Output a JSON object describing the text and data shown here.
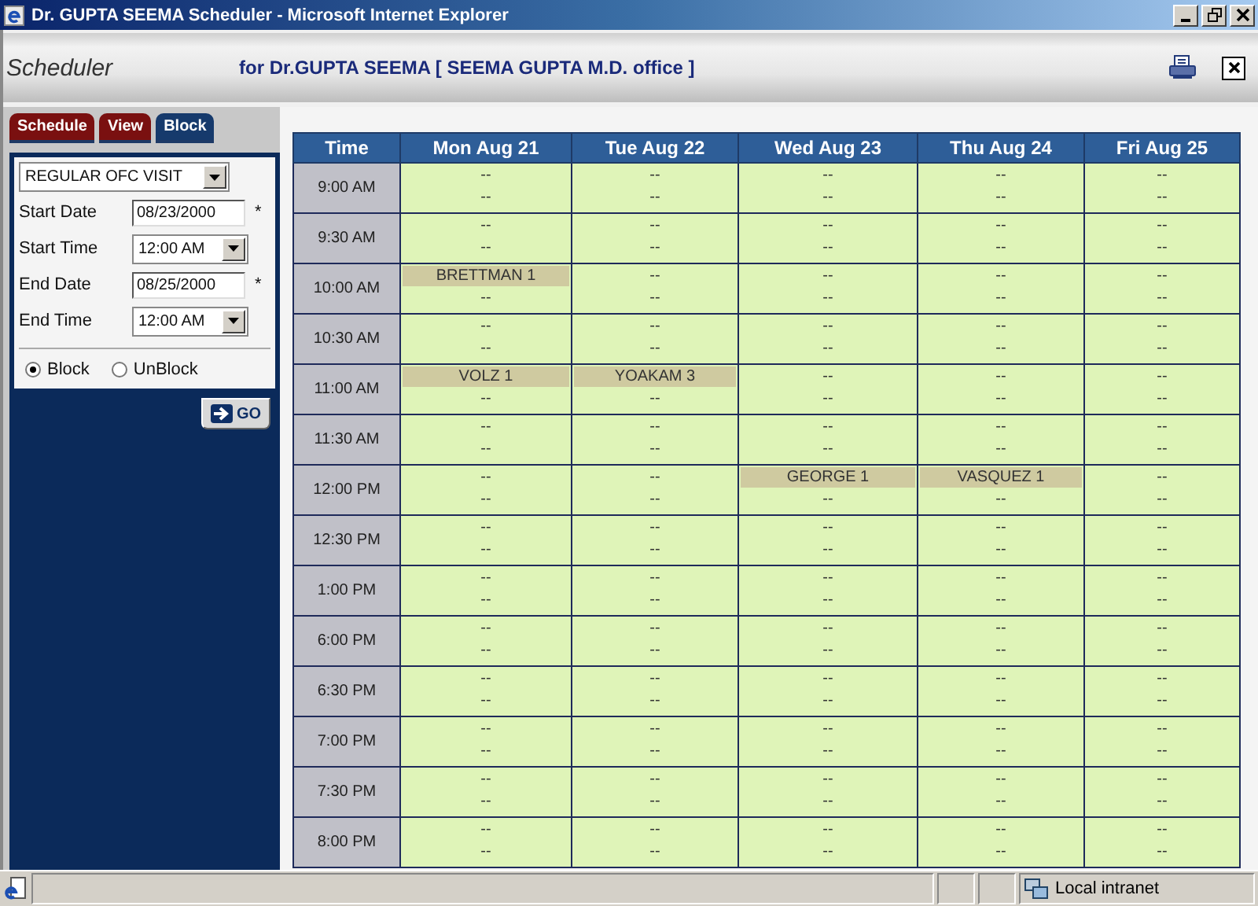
{
  "window": {
    "title": "Dr. GUPTA SEEMA Scheduler - Microsoft Internet Explorer"
  },
  "header": {
    "logo": "Scheduler",
    "subtitle": "for Dr.GUPTA SEEMA [ SEEMA GUPTA M.D. office ]"
  },
  "tabs": [
    {
      "label": "Schedule",
      "selected": false
    },
    {
      "label": "View",
      "selected": false
    },
    {
      "label": "Block",
      "selected": true
    }
  ],
  "form": {
    "visit_type": "REGULAR OFC VISIT",
    "fields": [
      {
        "kind": "date",
        "label": "Start Date",
        "value": "08/23/2000",
        "required_mark": "*"
      },
      {
        "kind": "select",
        "label": "Start Time",
        "value": "12:00 AM"
      },
      {
        "kind": "date",
        "label": "End Date",
        "value": "08/25/2000",
        "required_mark": "*"
      },
      {
        "kind": "select",
        "label": "End Time",
        "value": "12:00 AM"
      }
    ],
    "radios": [
      {
        "label": "Block",
        "selected": true
      },
      {
        "label": "UnBlock",
        "selected": false
      }
    ],
    "go_button": "GO"
  },
  "table": {
    "columns": [
      "Time",
      "Mon Aug 21",
      "Tue Aug 22",
      "Wed Aug 23",
      "Thu Aug 24",
      "Fri Aug 25"
    ],
    "rows": [
      {
        "cells": [
          {
            "kind": "time",
            "text": "9:00 AM"
          },
          {
            "kind": "slots",
            "slots": [
              {
                "text": "--",
                "booked": false
              },
              {
                "text": "--",
                "booked": false
              }
            ]
          },
          {
            "kind": "slots",
            "slots": [
              {
                "text": "--",
                "booked": false
              },
              {
                "text": "--",
                "booked": false
              }
            ]
          },
          {
            "kind": "slots",
            "slots": [
              {
                "text": "--",
                "booked": false
              },
              {
                "text": "--",
                "booked": false
              }
            ]
          },
          {
            "kind": "slots",
            "slots": [
              {
                "text": "--",
                "booked": false
              },
              {
                "text": "--",
                "booked": false
              }
            ]
          },
          {
            "kind": "slots",
            "slots": [
              {
                "text": "--",
                "booked": false
              },
              {
                "text": "--",
                "booked": false
              }
            ]
          }
        ]
      },
      {
        "cells": [
          {
            "kind": "time",
            "text": "9:30 AM"
          },
          {
            "kind": "slots",
            "slots": [
              {
                "text": "--",
                "booked": false
              },
              {
                "text": "--",
                "booked": false
              }
            ]
          },
          {
            "kind": "slots",
            "slots": [
              {
                "text": "--",
                "booked": false
              },
              {
                "text": "--",
                "booked": false
              }
            ]
          },
          {
            "kind": "slots",
            "slots": [
              {
                "text": "--",
                "booked": false
              },
              {
                "text": "--",
                "booked": false
              }
            ]
          },
          {
            "kind": "slots",
            "slots": [
              {
                "text": "--",
                "booked": false
              },
              {
                "text": "--",
                "booked": false
              }
            ]
          },
          {
            "kind": "slots",
            "slots": [
              {
                "text": "--",
                "booked": false
              },
              {
                "text": "--",
                "booked": false
              }
            ]
          }
        ]
      },
      {
        "cells": [
          {
            "kind": "time",
            "text": "10:00 AM"
          },
          {
            "kind": "slots",
            "slots": [
              {
                "text": "BRETTMAN 1",
                "booked": true
              },
              {
                "text": "--",
                "booked": false
              }
            ]
          },
          {
            "kind": "slots",
            "slots": [
              {
                "text": "--",
                "booked": false
              },
              {
                "text": "--",
                "booked": false
              }
            ]
          },
          {
            "kind": "slots",
            "slots": [
              {
                "text": "--",
                "booked": false
              },
              {
                "text": "--",
                "booked": false
              }
            ]
          },
          {
            "kind": "slots",
            "slots": [
              {
                "text": "--",
                "booked": false
              },
              {
                "text": "--",
                "booked": false
              }
            ]
          },
          {
            "kind": "slots",
            "slots": [
              {
                "text": "--",
                "booked": false
              },
              {
                "text": "--",
                "booked": false
              }
            ]
          }
        ]
      },
      {
        "cells": [
          {
            "kind": "time",
            "text": "10:30 AM"
          },
          {
            "kind": "slots",
            "slots": [
              {
                "text": "--",
                "booked": false
              },
              {
                "text": "--",
                "booked": false
              }
            ]
          },
          {
            "kind": "slots",
            "slots": [
              {
                "text": "--",
                "booked": false
              },
              {
                "text": "--",
                "booked": false
              }
            ]
          },
          {
            "kind": "slots",
            "slots": [
              {
                "text": "--",
                "booked": false
              },
              {
                "text": "--",
                "booked": false
              }
            ]
          },
          {
            "kind": "slots",
            "slots": [
              {
                "text": "--",
                "booked": false
              },
              {
                "text": "--",
                "booked": false
              }
            ]
          },
          {
            "kind": "slots",
            "slots": [
              {
                "text": "--",
                "booked": false
              },
              {
                "text": "--",
                "booked": false
              }
            ]
          }
        ]
      },
      {
        "cells": [
          {
            "kind": "time",
            "text": "11:00 AM"
          },
          {
            "kind": "slots",
            "slots": [
              {
                "text": "VOLZ 1",
                "booked": true
              },
              {
                "text": "--",
                "booked": false
              }
            ]
          },
          {
            "kind": "slots",
            "slots": [
              {
                "text": "YOAKAM 3",
                "booked": true
              },
              {
                "text": "--",
                "booked": false
              }
            ]
          },
          {
            "kind": "slots",
            "slots": [
              {
                "text": "--",
                "booked": false
              },
              {
                "text": "--",
                "booked": false
              }
            ]
          },
          {
            "kind": "slots",
            "slots": [
              {
                "text": "--",
                "booked": false
              },
              {
                "text": "--",
                "booked": false
              }
            ]
          },
          {
            "kind": "slots",
            "slots": [
              {
                "text": "--",
                "booked": false
              },
              {
                "text": "--",
                "booked": false
              }
            ]
          }
        ]
      },
      {
        "cells": [
          {
            "kind": "time",
            "text": "11:30 AM"
          },
          {
            "kind": "slots",
            "slots": [
              {
                "text": "--",
                "booked": false
              },
              {
                "text": "--",
                "booked": false
              }
            ]
          },
          {
            "kind": "slots",
            "slots": [
              {
                "text": "--",
                "booked": false
              },
              {
                "text": "--",
                "booked": false
              }
            ]
          },
          {
            "kind": "slots",
            "slots": [
              {
                "text": "--",
                "booked": false
              },
              {
                "text": "--",
                "booked": false
              }
            ]
          },
          {
            "kind": "slots",
            "slots": [
              {
                "text": "--",
                "booked": false
              },
              {
                "text": "--",
                "booked": false
              }
            ]
          },
          {
            "kind": "slots",
            "slots": [
              {
                "text": "--",
                "booked": false
              },
              {
                "text": "--",
                "booked": false
              }
            ]
          }
        ]
      },
      {
        "cells": [
          {
            "kind": "time",
            "text": "12:00 PM"
          },
          {
            "kind": "slots",
            "slots": [
              {
                "text": "--",
                "booked": false
              },
              {
                "text": "--",
                "booked": false
              }
            ]
          },
          {
            "kind": "slots",
            "slots": [
              {
                "text": "--",
                "booked": false
              },
              {
                "text": "--",
                "booked": false
              }
            ]
          },
          {
            "kind": "slots",
            "slots": [
              {
                "text": "GEORGE 1",
                "booked": true
              },
              {
                "text": "--",
                "booked": false
              }
            ]
          },
          {
            "kind": "slots",
            "slots": [
              {
                "text": "VASQUEZ 1",
                "booked": true
              },
              {
                "text": "--",
                "booked": false
              }
            ]
          },
          {
            "kind": "slots",
            "slots": [
              {
                "text": "--",
                "booked": false
              },
              {
                "text": "--",
                "booked": false
              }
            ]
          }
        ]
      },
      {
        "cells": [
          {
            "kind": "time",
            "text": "12:30 PM"
          },
          {
            "kind": "slots",
            "slots": [
              {
                "text": "--",
                "booked": false
              },
              {
                "text": "--",
                "booked": false
              }
            ]
          },
          {
            "kind": "slots",
            "slots": [
              {
                "text": "--",
                "booked": false
              },
              {
                "text": "--",
                "booked": false
              }
            ]
          },
          {
            "kind": "slots",
            "slots": [
              {
                "text": "--",
                "booked": false
              },
              {
                "text": "--",
                "booked": false
              }
            ]
          },
          {
            "kind": "slots",
            "slots": [
              {
                "text": "--",
                "booked": false
              },
              {
                "text": "--",
                "booked": false
              }
            ]
          },
          {
            "kind": "slots",
            "slots": [
              {
                "text": "--",
                "booked": false
              },
              {
                "text": "--",
                "booked": false
              }
            ]
          }
        ]
      },
      {
        "cells": [
          {
            "kind": "time",
            "text": "1:00 PM"
          },
          {
            "kind": "slots",
            "slots": [
              {
                "text": "--",
                "booked": false
              },
              {
                "text": "--",
                "booked": false
              }
            ]
          },
          {
            "kind": "slots",
            "slots": [
              {
                "text": "--",
                "booked": false
              },
              {
                "text": "--",
                "booked": false
              }
            ]
          },
          {
            "kind": "slots",
            "slots": [
              {
                "text": "--",
                "booked": false
              },
              {
                "text": "--",
                "booked": false
              }
            ]
          },
          {
            "kind": "slots",
            "slots": [
              {
                "text": "--",
                "booked": false
              },
              {
                "text": "--",
                "booked": false
              }
            ]
          },
          {
            "kind": "slots",
            "slots": [
              {
                "text": "--",
                "booked": false
              },
              {
                "text": "--",
                "booked": false
              }
            ]
          }
        ]
      },
      {
        "cells": [
          {
            "kind": "time",
            "text": "6:00 PM"
          },
          {
            "kind": "slots",
            "slots": [
              {
                "text": "--",
                "booked": false
              },
              {
                "text": "--",
                "booked": false
              }
            ]
          },
          {
            "kind": "slots",
            "slots": [
              {
                "text": "--",
                "booked": false
              },
              {
                "text": "--",
                "booked": false
              }
            ]
          },
          {
            "kind": "slots",
            "slots": [
              {
                "text": "--",
                "booked": false
              },
              {
                "text": "--",
                "booked": false
              }
            ]
          },
          {
            "kind": "slots",
            "slots": [
              {
                "text": "--",
                "booked": false
              },
              {
                "text": "--",
                "booked": false
              }
            ]
          },
          {
            "kind": "slots",
            "slots": [
              {
                "text": "--",
                "booked": false
              },
              {
                "text": "--",
                "booked": false
              }
            ]
          }
        ]
      },
      {
        "cells": [
          {
            "kind": "time",
            "text": "6:30 PM"
          },
          {
            "kind": "slots",
            "slots": [
              {
                "text": "--",
                "booked": false
              },
              {
                "text": "--",
                "booked": false
              }
            ]
          },
          {
            "kind": "slots",
            "slots": [
              {
                "text": "--",
                "booked": false
              },
              {
                "text": "--",
                "booked": false
              }
            ]
          },
          {
            "kind": "slots",
            "slots": [
              {
                "text": "--",
                "booked": false
              },
              {
                "text": "--",
                "booked": false
              }
            ]
          },
          {
            "kind": "slots",
            "slots": [
              {
                "text": "--",
                "booked": false
              },
              {
                "text": "--",
                "booked": false
              }
            ]
          },
          {
            "kind": "slots",
            "slots": [
              {
                "text": "--",
                "booked": false
              },
              {
                "text": "--",
                "booked": false
              }
            ]
          }
        ]
      },
      {
        "cells": [
          {
            "kind": "time",
            "text": "7:00 PM"
          },
          {
            "kind": "slots",
            "slots": [
              {
                "text": "--",
                "booked": false
              },
              {
                "text": "--",
                "booked": false
              }
            ]
          },
          {
            "kind": "slots",
            "slots": [
              {
                "text": "--",
                "booked": false
              },
              {
                "text": "--",
                "booked": false
              }
            ]
          },
          {
            "kind": "slots",
            "slots": [
              {
                "text": "--",
                "booked": false
              },
              {
                "text": "--",
                "booked": false
              }
            ]
          },
          {
            "kind": "slots",
            "slots": [
              {
                "text": "--",
                "booked": false
              },
              {
                "text": "--",
                "booked": false
              }
            ]
          },
          {
            "kind": "slots",
            "slots": [
              {
                "text": "--",
                "booked": false
              },
              {
                "text": "--",
                "booked": false
              }
            ]
          }
        ]
      },
      {
        "cells": [
          {
            "kind": "time",
            "text": "7:30 PM"
          },
          {
            "kind": "slots",
            "slots": [
              {
                "text": "--",
                "booked": false
              },
              {
                "text": "--",
                "booked": false
              }
            ]
          },
          {
            "kind": "slots",
            "slots": [
              {
                "text": "--",
                "booked": false
              },
              {
                "text": "--",
                "booked": false
              }
            ]
          },
          {
            "kind": "slots",
            "slots": [
              {
                "text": "--",
                "booked": false
              },
              {
                "text": "--",
                "booked": false
              }
            ]
          },
          {
            "kind": "slots",
            "slots": [
              {
                "text": "--",
                "booked": false
              },
              {
                "text": "--",
                "booked": false
              }
            ]
          },
          {
            "kind": "slots",
            "slots": [
              {
                "text": "--",
                "booked": false
              },
              {
                "text": "--",
                "booked": false
              }
            ]
          }
        ]
      },
      {
        "cells": [
          {
            "kind": "time",
            "text": "8:00 PM"
          },
          {
            "kind": "slots",
            "slots": [
              {
                "text": "--",
                "booked": false
              },
              {
                "text": "--",
                "booked": false
              }
            ]
          },
          {
            "kind": "slots",
            "slots": [
              {
                "text": "--",
                "booked": false
              },
              {
                "text": "--",
                "booked": false
              }
            ]
          },
          {
            "kind": "slots",
            "slots": [
              {
                "text": "--",
                "booked": false
              },
              {
                "text": "--",
                "booked": false
              }
            ]
          },
          {
            "kind": "slots",
            "slots": [
              {
                "text": "--",
                "booked": false
              },
              {
                "text": "--",
                "booked": false
              }
            ]
          },
          {
            "kind": "slots",
            "slots": [
              {
                "text": "--",
                "booked": false
              },
              {
                "text": "--",
                "booked": false
              }
            ]
          }
        ]
      }
    ]
  },
  "status_bar": {
    "zone": "Local intranet"
  }
}
